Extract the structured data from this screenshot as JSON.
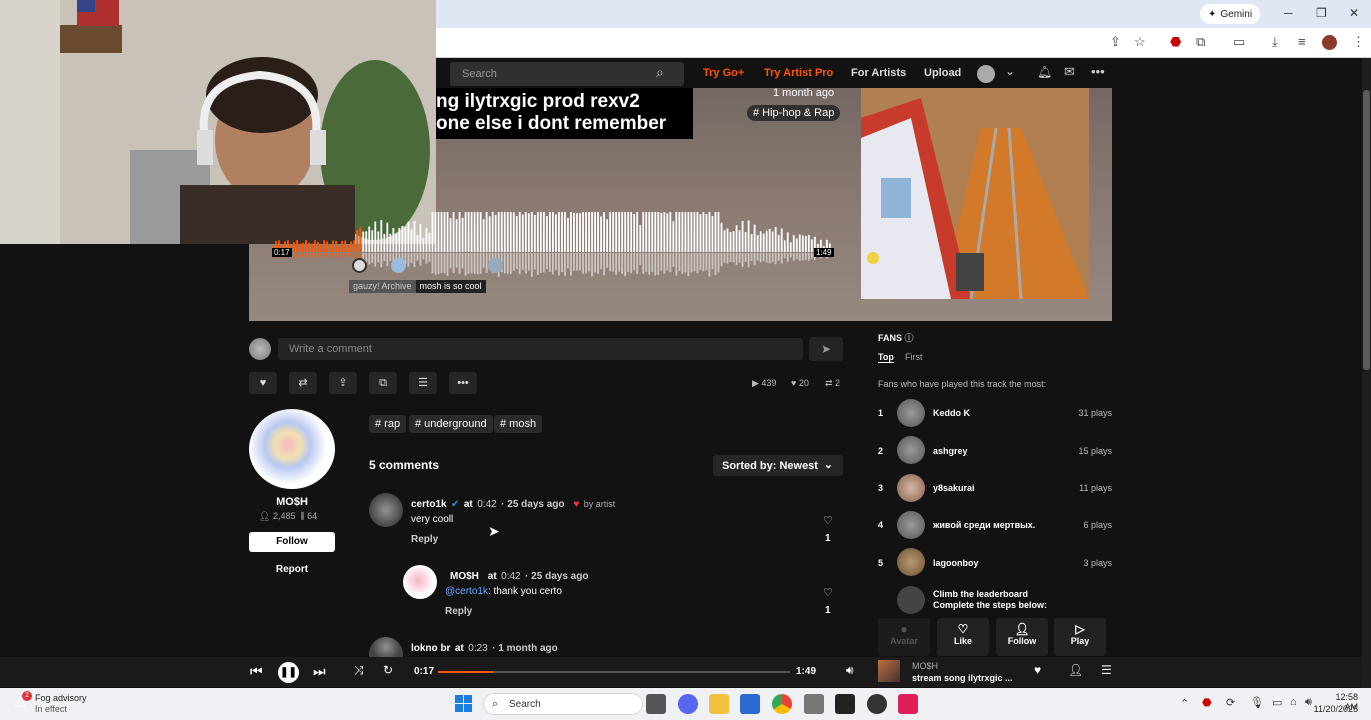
{
  "browser": {
    "gemini_label": "Gemini",
    "minimize": "─",
    "maximize": "❐",
    "close": "✕"
  },
  "header": {
    "search_placeholder": "Search",
    "try_go": "Try Go+",
    "try_artist_pro": "Try Artist Pro",
    "for_artists": "For Artists",
    "upload": "Upload",
    "accent": "#ff5500"
  },
  "track": {
    "title_line1": "ng ilytrxgic prod rexv2",
    "title_line2": "one else i dont remember",
    "posted": "1 month ago",
    "genre": "# Hip-hop & Rap",
    "time_current": "0:17",
    "time_total": "1:49",
    "progress": 0.156,
    "waveform_comment_user": "gauzy! Archive",
    "waveform_comment_text": "mosh is so cool"
  },
  "comment_bar": {
    "placeholder": "Write a comment"
  },
  "stats": {
    "plays": "439",
    "likes": "20",
    "reposts": "2"
  },
  "tags": [
    "# rap",
    "# underground",
    "# mosh"
  ],
  "profile": {
    "name": "MO$H",
    "followers": "2,485",
    "tracks": "64",
    "follow_label": "Follow",
    "report_label": "Report"
  },
  "comments": {
    "count_label": "5 comments",
    "sort_label": "Sorted by: Newest",
    "items": [
      {
        "user": "certo1k",
        "at": "at",
        "time": "0:42",
        "ago": "· 25 days ago",
        "by_artist": "by artist",
        "text": "very cooll",
        "reply": "Reply",
        "likes": "1"
      },
      {
        "user": "MO$H",
        "at": "at",
        "time": "0:42",
        "ago": "· 25 days ago",
        "mention": "@certo1k",
        "text": ": thank you certo",
        "reply": "Reply",
        "likes": "1"
      },
      {
        "user": "lokno br",
        "at": "at",
        "time": "0:23",
        "ago": "· 1 month ago"
      }
    ]
  },
  "fans": {
    "title": "FANS",
    "tab_top": "Top",
    "tab_first": "First",
    "description": "Fans who have played this track the most:",
    "list": [
      {
        "rank": "1",
        "name": "Keddo K",
        "plays": "31 plays"
      },
      {
        "rank": "2",
        "name": "ashgrey",
        "plays": "15 plays"
      },
      {
        "rank": "3",
        "name": "y8sakurai",
        "plays": "11 plays"
      },
      {
        "rank": "4",
        "name": "живой среди мертвых.",
        "plays": "6 plays"
      },
      {
        "rank": "5",
        "name": "lagoonboy",
        "plays": "3 plays"
      }
    ],
    "climb_title": "Climb the leaderboard",
    "climb_sub": "Complete the steps below:",
    "steps": [
      "Avatar",
      "Like",
      "Follow",
      "Play"
    ]
  },
  "player": {
    "time_current": "0:17",
    "time_total": "1:49",
    "progress": 0.156,
    "artist": "MO$H",
    "title": "stream song ilytrxgic ..."
  },
  "taskbar": {
    "weather_title": "Fog advisory",
    "weather_sub": "In effect",
    "weather_badge": "2",
    "search_label": "Search",
    "time": "12:58 AM",
    "date": "11/20/2025"
  }
}
